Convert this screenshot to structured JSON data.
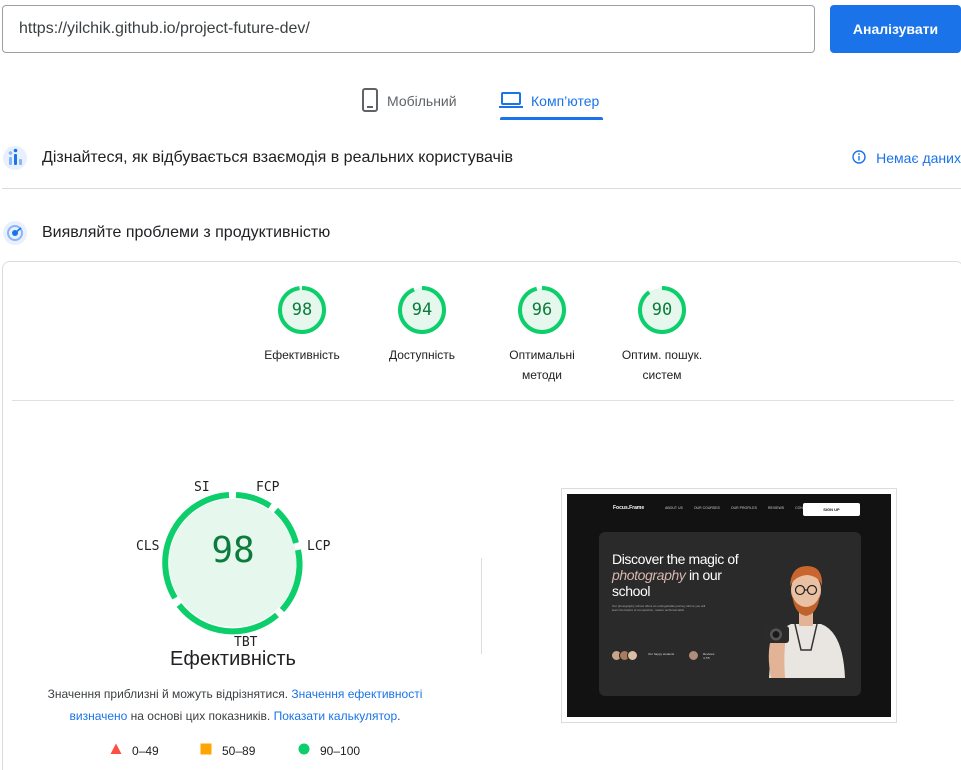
{
  "search": {
    "url": "https://yilchik.github.io/project-future-dev/",
    "button_label": "Аналізувати"
  },
  "tabs": [
    {
      "label": "Мобільний",
      "icon": "phone-icon",
      "active": false
    },
    {
      "label": "Комп’ютер",
      "icon": "laptop-icon",
      "active": true
    }
  ],
  "field_data": {
    "title": "Дізнайтеся, як відбувається взаємодія в реальних користувачів",
    "status": "Немає даних",
    "icon": "users-chart-icon"
  },
  "lab_data": {
    "title": "Виявляйте проблеми з продуктивністю",
    "icon": "speedometer-icon"
  },
  "scores": [
    {
      "label_lines": [
        "Ефективність"
      ],
      "score": "98"
    },
    {
      "label_lines": [
        "Доступність"
      ],
      "score": "94"
    },
    {
      "label_lines": [
        "Оптимальні",
        "методи"
      ],
      "score": "96"
    },
    {
      "label_lines": [
        "Оптим. пошук.",
        "систем"
      ],
      "score": "90"
    }
  ],
  "performance": {
    "score": "98",
    "title": "Ефективність",
    "metrics": [
      "SI",
      "FCP",
      "LCP",
      "TBT",
      "CLS"
    ],
    "note": {
      "text1": "Значення приблизні й можуть відрізнятися. ",
      "link1": "Значення ефективності визначено",
      "text2": " на основі цих показників. ",
      "link2": "Показати калькулятор",
      "text3": "."
    },
    "legend": [
      {
        "range": "0–49",
        "color": "#ff4e42",
        "shape": "triangle"
      },
      {
        "range": "50–89",
        "color": "#ffa400",
        "shape": "square"
      },
      {
        "range": "90–100",
        "color": "#0cce6b",
        "shape": "circle"
      }
    ]
  },
  "colors": {
    "accent": "#1a73e8",
    "pass": "#0cce6b",
    "pass_text": "#0c7c3c",
    "pass_fill": "#e6f8ed"
  },
  "screenshot": {
    "logo": "Focus.Frame",
    "nav_links": [
      "ABOUT US",
      "OUR COURSES",
      "OUR PROFILES",
      "REVIEWS",
      "CONTACTS"
    ],
    "signup": "SIGN UP",
    "hero_title_1": "Discover the magic of",
    "hero_title_accent": "photography",
    "hero_title_2": " in our",
    "hero_title_3": "school",
    "hero_body": "Our photography school offers an unforgettable journey where you will learn the basics of composition, master technical skills",
    "people_text": "Our happy students",
    "stat_text": "Reviews 4,7/5"
  }
}
